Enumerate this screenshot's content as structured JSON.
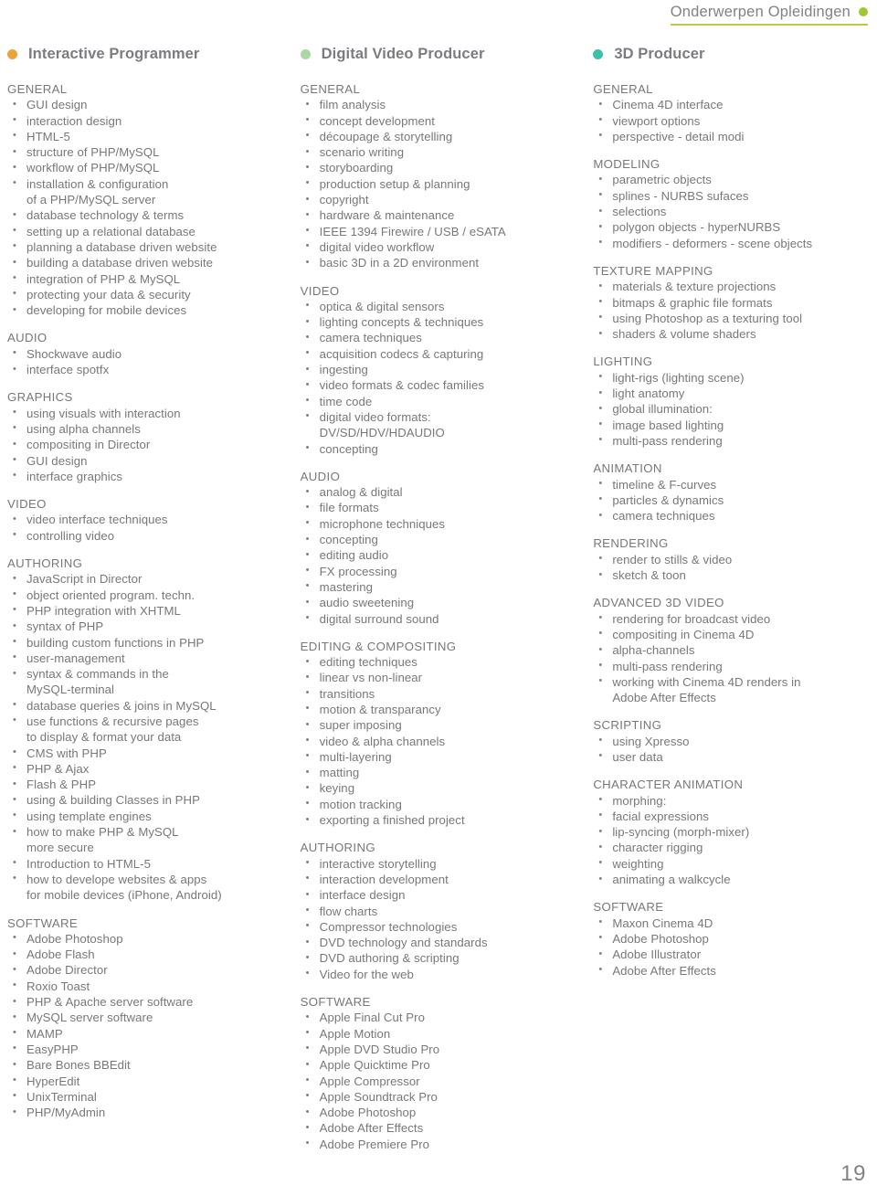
{
  "header": {
    "title": "Onderwerpen Opleidingen",
    "dot_color": "#9fc830",
    "rule_color": "#b5cf3f"
  },
  "page_number": "19",
  "columns": [
    {
      "title": "Interactive Programmer",
      "dot_color": "#eba43a",
      "groups": [
        {
          "title": "GENERAL",
          "items": [
            "GUI design",
            "interaction design",
            "HTML-5",
            "structure of PHP/MySQL",
            "workflow of PHP/MySQL",
            "installation & configuration\nof a PHP/MySQL server",
            "database technology & terms",
            "setting up a relational database",
            "planning a database driven website",
            "building a database driven website",
            "integration of PHP & MySQL",
            "protecting your data & security",
            "developing for mobile devices"
          ]
        },
        {
          "title": "AUDIO",
          "items": [
            "Shockwave audio",
            "interface spotfx"
          ]
        },
        {
          "title": "GRAPHICS",
          "items": [
            "using visuals with interaction",
            "using alpha channels",
            "compositing in Director",
            "GUI design",
            "interface graphics"
          ]
        },
        {
          "title": "VIDEO",
          "items": [
            "video interface techniques",
            "controlling video"
          ]
        },
        {
          "title": "AUTHORING",
          "items": [
            "JavaScript in Director",
            "object oriented program. techn.",
            "PHP integration with XHTML",
            "syntax of PHP",
            "building custom functions in PHP",
            "user-management",
            "syntax & commands in the\nMySQL-terminal",
            "database queries & joins in MySQL",
            "use functions & recursive pages\nto display & format your data",
            "CMS with PHP",
            "PHP & Ajax",
            "Flash & PHP",
            "using & building Classes in PHP",
            "using template engines",
            "how to make PHP & MySQL\nmore secure",
            "Introduction to HTML-5",
            "how to develope websites & apps\nfor mobile devices (iPhone, Android)"
          ]
        },
        {
          "title": "SOFTWARE",
          "items": [
            "Adobe Photoshop",
            "Adobe Flash",
            "Adobe Director",
            "Roxio Toast",
            "PHP & Apache server software",
            "MySQL server software",
            "MAMP",
            "EasyPHP",
            "Bare Bones BBEdit",
            "HyperEdit",
            "UnixTerminal",
            "PHP/MyAdmin"
          ]
        }
      ]
    },
    {
      "title": "Digital Video Producer",
      "dot_color": "#a9d8a3",
      "groups": [
        {
          "title": "GENERAL",
          "items": [
            "film analysis",
            "concept development",
            "découpage & storytelling",
            "scenario writing",
            "storyboarding",
            "production setup & planning",
            "copyright",
            "hardware & maintenance",
            "IEEE 1394 Firewire / USB / eSATA",
            "digital video workflow",
            "basic 3D in a 2D environment"
          ]
        },
        {
          "title": "VIDEO",
          "items": [
            "optica & digital sensors",
            "lighting concepts & techniques",
            "camera techniques",
            "acquisition codecs & capturing",
            "ingesting",
            "video formats & codec families",
            "time code",
            "digital video formats:\nDV/SD/HDV/HDAUDIO",
            "concepting"
          ]
        },
        {
          "title": "AUDIO",
          "items": [
            "analog & digital",
            "file formats",
            "microphone techniques",
            "concepting",
            "editing audio",
            "FX processing",
            "mastering",
            "audio sweetening",
            "digital surround sound"
          ]
        },
        {
          "title": "EDITING & COMPOSITING",
          "items": [
            "editing techniques",
            "linear vs non-linear",
            "transitions",
            "motion & transparancy",
            "super imposing",
            "video & alpha channels",
            "multi-layering",
            "matting",
            "keying",
            "motion tracking",
            "exporting a finished project"
          ]
        },
        {
          "title": "AUTHORING",
          "items": [
            "interactive storytelling",
            "interaction development",
            "interface design",
            "flow charts",
            "Compressor technologies",
            "DVD technology and standards",
            "DVD authoring & scripting",
            "Video for the web"
          ]
        },
        {
          "title": "SOFTWARE",
          "items": [
            "Apple Final Cut Pro",
            "Apple Motion",
            "Apple DVD Studio Pro",
            "Apple Quicktime Pro",
            "Apple Compressor",
            "Apple Soundtrack Pro",
            "Adobe Photoshop",
            "Adobe After Effects",
            "Adobe Premiere Pro"
          ]
        }
      ]
    },
    {
      "title": "3D Producer",
      "dot_color": "#3dbfa8",
      "groups": [
        {
          "title": "GENERAL",
          "items": [
            "Cinema 4D interface",
            "viewport options",
            "perspective - detail modi"
          ]
        },
        {
          "title": "MODELING",
          "items": [
            "parametric objects",
            "splines - NURBS sufaces",
            "selections",
            "polygon objects - hyperNURBS",
            "modifiers - deformers - scene objects"
          ]
        },
        {
          "title": "TEXTURE MAPPING",
          "items": [
            "materials & texture projections",
            "bitmaps & graphic file formats",
            "using Photoshop as a texturing tool",
            "shaders & volume shaders"
          ]
        },
        {
          "title": "LIGHTING",
          "items": [
            "light-rigs (lighting scene)",
            "light anatomy",
            "global illumination:",
            "image based lighting",
            "multi-pass rendering"
          ]
        },
        {
          "title": "ANIMATION",
          "items": [
            "timeline & F-curves",
            "particles & dynamics",
            "camera techniques"
          ]
        },
        {
          "title": "RENDERING",
          "items": [
            "render to stills & video",
            "sketch & toon"
          ]
        },
        {
          "title": "ADVANCED 3D VIDEO",
          "items": [
            "rendering for broadcast video",
            "compositing in Cinema 4D",
            "alpha-channels",
            "multi-pass rendering",
            "working with Cinema 4D renders in\nAdobe After Effects"
          ]
        },
        {
          "title": "SCRIPTING",
          "items": [
            "using Xpresso",
            "user data"
          ]
        },
        {
          "title": "CHARACTER ANIMATION",
          "items": [
            "morphing:",
            "facial expressions",
            "lip-syncing (morph-mixer)",
            "character rigging",
            "weighting",
            "animating a walkcycle"
          ]
        },
        {
          "title": "SOFTWARE",
          "items": [
            "Maxon Cinema 4D",
            "Adobe Photoshop",
            "Adobe Illustrator",
            "Adobe After Effects"
          ]
        }
      ]
    }
  ]
}
